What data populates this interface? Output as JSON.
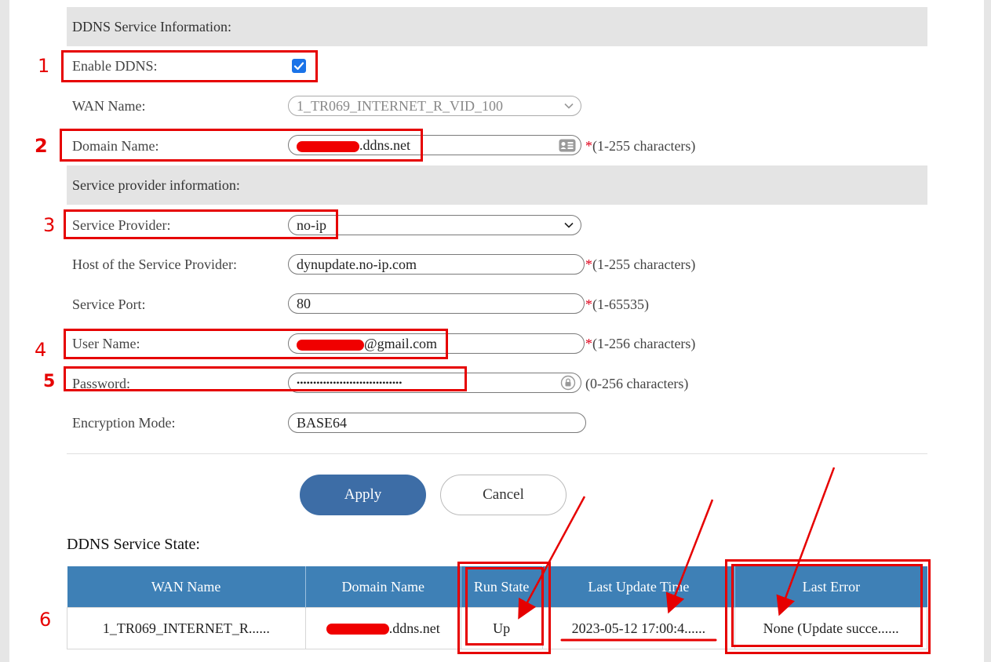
{
  "sections": {
    "service_info": "DDNS Service Information:",
    "provider_info": "Service provider information:"
  },
  "form": {
    "enable_ddns": {
      "label": "Enable DDNS:",
      "checked": true
    },
    "wan_name": {
      "label": "WAN Name:",
      "value": "1_TR069_INTERNET_R_VID_100"
    },
    "domain_name": {
      "label": "Domain Name:",
      "value_suffix": ".ddns.net",
      "hint_star": "*",
      "hint": "(1-255 characters)"
    },
    "service_provider": {
      "label": "Service Provider:",
      "value": "no-ip"
    },
    "host": {
      "label": "Host of the Service Provider:",
      "value": "dynupdate.no-ip.com",
      "hint_star": "*",
      "hint": "(1-255 characters)"
    },
    "service_port": {
      "label": "Service Port:",
      "value": "80",
      "hint_star": "*",
      "hint": "(1-65535)"
    },
    "user_name": {
      "label": "User Name:",
      "value_suffix": "@gmail.com",
      "hint_star": "*",
      "hint": "(1-256 characters)"
    },
    "password": {
      "label": "Password:",
      "value": "••••••••••••••••••••••••••••••••",
      "hint": "(0-256 characters)"
    },
    "encryption_mode": {
      "label": "Encryption Mode:",
      "value": "BASE64"
    }
  },
  "buttons": {
    "apply": "Apply",
    "cancel": "Cancel"
  },
  "state": {
    "title": "DDNS Service State:",
    "columns": [
      "WAN Name",
      "Domain Name",
      "Run State",
      "Last Update Time",
      "Last Error"
    ],
    "row": {
      "wan_name": "1_TR069_INTERNET_R......",
      "domain_suffix": ".ddns.net",
      "run_state": "Up",
      "last_update": "2023-05-12 17:00:4......",
      "last_error": "None (Update succe......"
    }
  },
  "annotations": [
    "1",
    "2",
    "3",
    "4",
    "5",
    "6"
  ],
  "colors": {
    "header_blue": "#3e80b6",
    "apply_blue": "#3d6da6",
    "required_star": "#e0001a",
    "annotation_red": "#e60000",
    "checkbox_blue": "#1a73e8"
  }
}
